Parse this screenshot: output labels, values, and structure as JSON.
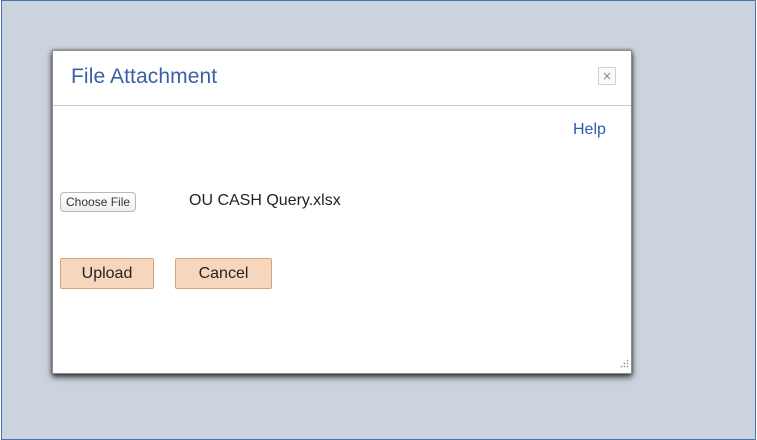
{
  "dialog": {
    "title": "File Attachment",
    "close_icon": "close-icon",
    "close_glyph": "×",
    "help_label": "Help",
    "choose_file_label": "Choose File",
    "selected_file": "OU CASH Query.xlsx",
    "upload_label": "Upload",
    "cancel_label": "Cancel"
  },
  "colors": {
    "backdrop": "#cbd3dd",
    "title": "#3b5ea8",
    "link": "#2e5ab3",
    "button_bg": "#f6d7bd",
    "button_border": "#d7a37a"
  }
}
